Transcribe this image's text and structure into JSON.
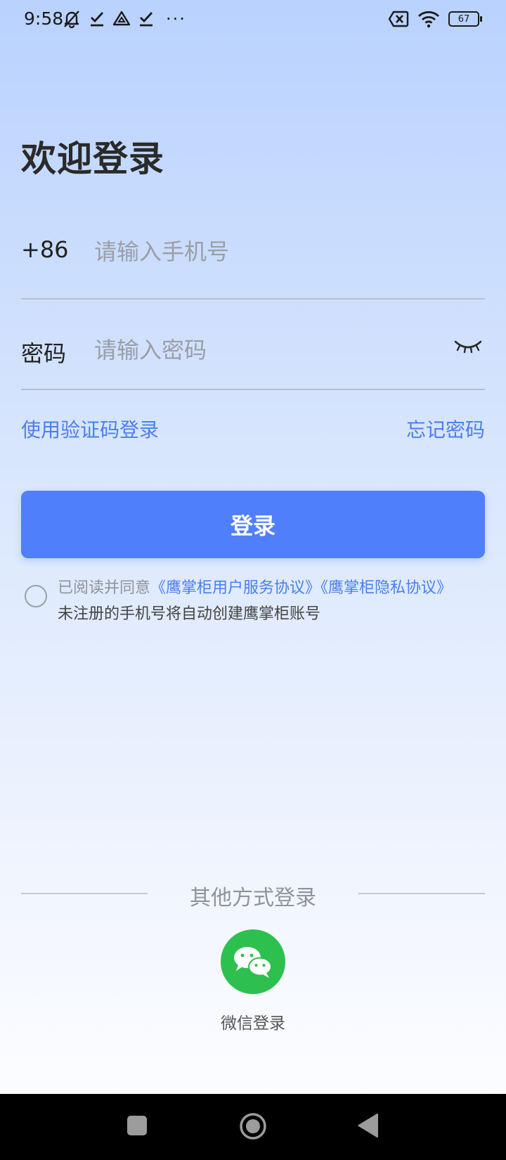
{
  "status_bar": {
    "time": "9:58",
    "battery_level": "67",
    "icons": [
      "mute-bell-icon",
      "check-icon",
      "drive-icon",
      "check-icon",
      "more-dots-icon",
      "sim-off-icon",
      "wifi-icon",
      "battery-icon"
    ],
    "more_dots": "···"
  },
  "login": {
    "title": "欢迎登录",
    "phone_prefix": "+86",
    "phone_placeholder": "请输入手机号",
    "password_label": "密码",
    "password_placeholder": "请输入密码",
    "sms_login_link": "使用验证码登录",
    "forgot_password_link": "忘记密码",
    "login_button": "登录"
  },
  "agreement": {
    "prefix": "已阅读并同意",
    "user_agreement": "《鹰掌柜用户服务协议》",
    "privacy_agreement": "《鹰掌柜隐私协议》",
    "note": "未注册的手机号将自动创建鹰掌柜账号"
  },
  "other_login": {
    "title": "其他方式登录",
    "wechat_label": "微信登录"
  },
  "colors": {
    "accent": "#4f7ffa",
    "link": "#4a7ef2",
    "wechat": "#2dc04e"
  }
}
